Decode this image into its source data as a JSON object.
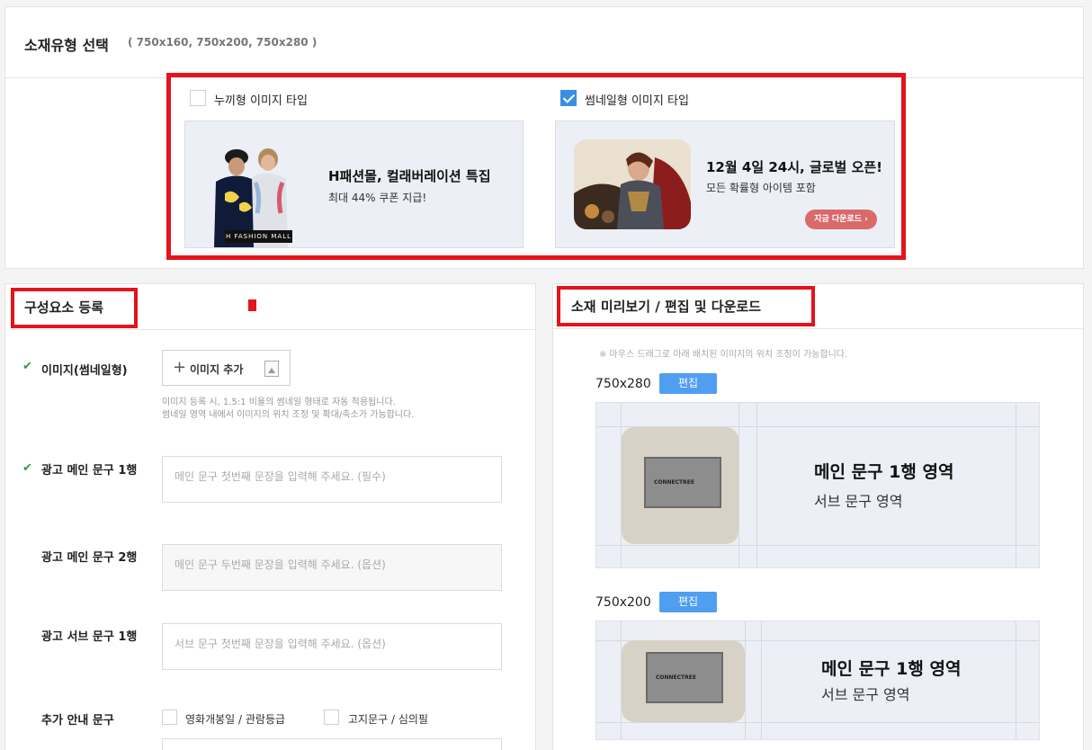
{
  "type_section": {
    "title": "소재유형 선택",
    "sizes": "( 750x160, 750x200, 750x280 )",
    "options": [
      {
        "label": "누끼형 이미지 타입",
        "checked": false
      },
      {
        "label": "썸네일형 이미지 타입",
        "checked": true
      }
    ],
    "banner_cutout": {
      "title": "H패션몰, 컬래버레이션 특집",
      "sub": "최대 44% 쿠폰 지급!",
      "tag": "H FASHION MALL"
    },
    "banner_thumb": {
      "title": "12월 4일 24시, 글로벌 오픈!",
      "sub": "모든 확률형 아이템 포함",
      "button": "지금 다운로드 ›"
    }
  },
  "register": {
    "title": "구성요소 등록",
    "image_label": "이미지(썸네일형)",
    "add_image": "이미지 추가",
    "help_line1": "이미지 등록 시, 1.5:1 비율의 썸네일 형태로 자동 적용됩니다.",
    "help_line2": "썸네일 영역 내에서 이미지의 위치 조정 및 확대/축소가 가능합니다.",
    "main1_label": "광고 메인 문구 1행",
    "main1_placeholder": "메인 문구 첫번째 문장을 입력해 주세요. (필수)",
    "main2_label": "광고 메인 문구 2행",
    "main2_placeholder": "메인 문구 두번째 문장을 입력해 주세요. (옵션)",
    "sub1_label": "광고 서브 문구 1행",
    "sub1_placeholder": "서브 문구 첫번째 문장을 입력해 주세요. (옵션)",
    "extra_label": "추가 안내 문구",
    "extra_opt1": "영화개봉일 / 관람등급",
    "extra_opt2": "고지문구 / 심의필"
  },
  "preview": {
    "title": "소재 미리보기 / 편집 및 다운로드",
    "note": "※ 마우스 드래그로 아래 배치된 이미지의 위치 조정이 가능합니다.",
    "edit": "편집",
    "logo": "CONNECTREE",
    "main_text": "메인 문구 1행 영역",
    "sub_text": "서브 문구 영역",
    "items": [
      {
        "size": "750x280"
      },
      {
        "size": "750x200"
      }
    ]
  },
  "colors": {
    "accent_red": "#e2141c",
    "accent_blue": "#4f9ef0",
    "check_green": "#2e9a4a"
  }
}
